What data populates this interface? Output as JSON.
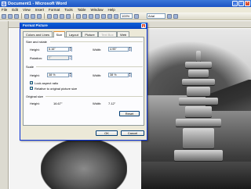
{
  "window": {
    "title": "Document1 - Microsoft Word"
  },
  "menu": [
    "File",
    "Edit",
    "View",
    "Insert",
    "Format",
    "Tools",
    "Table",
    "Window",
    "Help"
  ],
  "toolbar": {
    "zoom": "100%",
    "font": "Arial"
  },
  "dialog": {
    "title": "Format Picture",
    "close_label": "x",
    "tabs": [
      {
        "label": "Colors and Lines",
        "state": "normal"
      },
      {
        "label": "Size",
        "state": "active"
      },
      {
        "label": "Layout",
        "state": "normal"
      },
      {
        "label": "Picture",
        "state": "normal"
      },
      {
        "label": "Text Box",
        "state": "disabled"
      },
      {
        "label": "Web",
        "state": "normal"
      }
    ],
    "size_rotate": {
      "section_label": "Size and rotate",
      "height_label": "Height:",
      "height_value": "6.16\"",
      "width_label": "Width:",
      "width_value": "4.95\"",
      "rotation_label": "Rotation:",
      "rotation_value": "0°"
    },
    "scale": {
      "section_label": "Scale",
      "height_label": "Height:",
      "height_value": "38 %",
      "width_label": "Width:",
      "width_value": "38 %",
      "lock_aspect_label": "Lock aspect ratio",
      "lock_aspect_checked": true,
      "relative_label": "Relative to original picture size",
      "relative_checked": true
    },
    "original_size": {
      "section_label": "Original size",
      "height_label": "Height:",
      "height_value": "16.67\"",
      "width_label": "Width:",
      "width_value": "7.12\""
    },
    "reset_label": "Reset",
    "ok_label": "OK",
    "cancel_label": "Cancel"
  },
  "colors": {
    "title_bar": "#1c54c4",
    "dialog_bg": "#ece9d8",
    "active_tab_accent": "#e68b2c"
  }
}
